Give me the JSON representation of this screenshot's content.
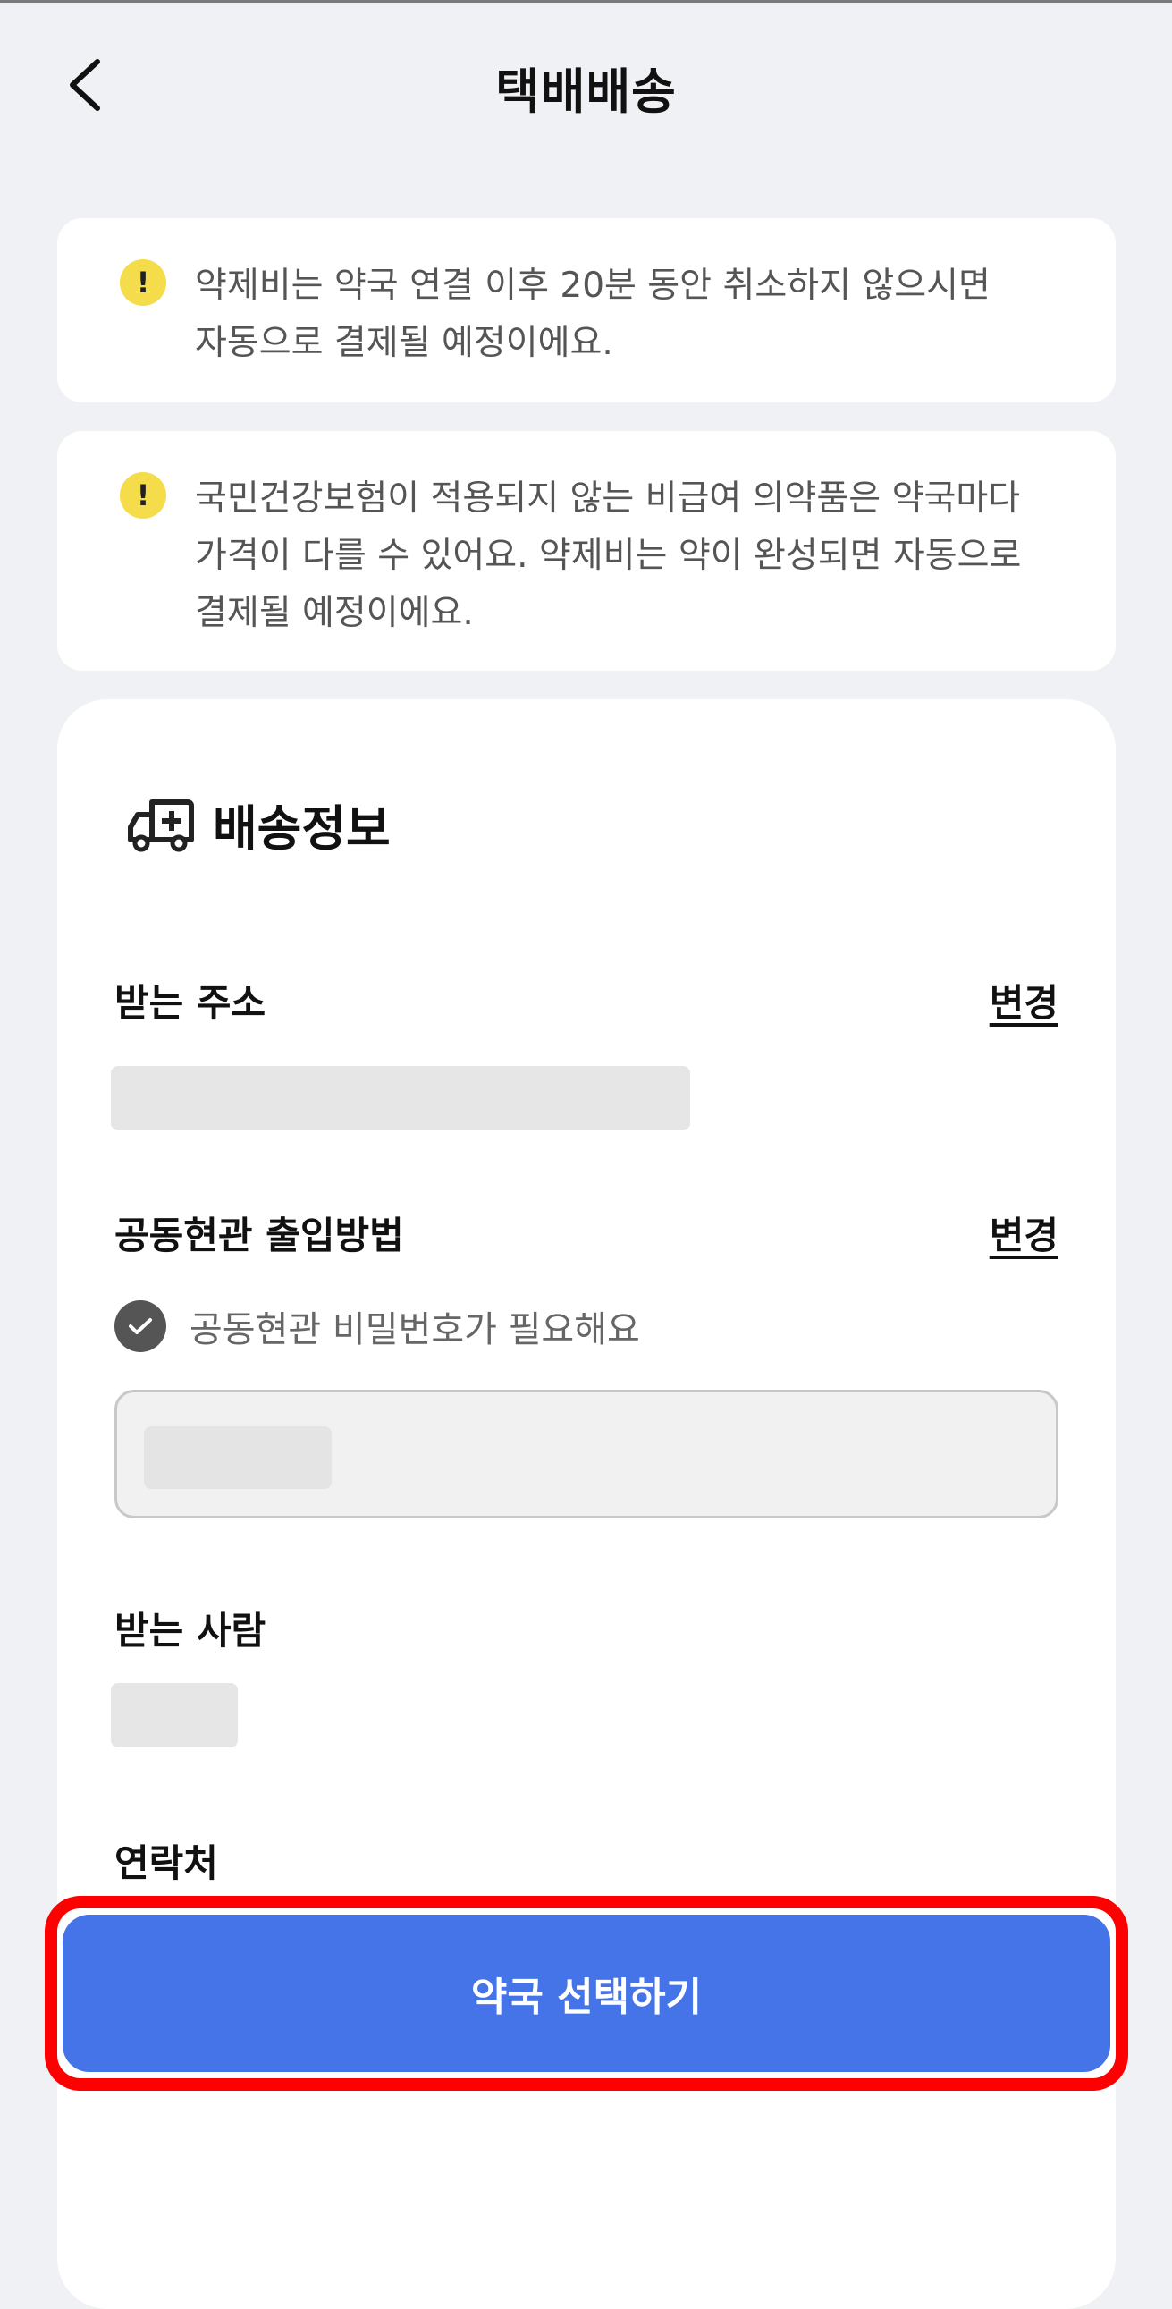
{
  "header": {
    "title": "택배배송"
  },
  "notices": [
    {
      "lines": [
        "약제비는 약국 연결 이후 20분 동안 취소하지 않으시면",
        "자동으로 결제될 예정이에요."
      ]
    },
    {
      "lines": [
        "국민건강보험이 적용되지 않는 비급여 의약품은 약국마다",
        "가격이 다를 수 있어요. 약제비는 약이 완성되면 자동으로",
        "결제될 예정이에요."
      ]
    }
  ],
  "warning_mark": "!",
  "delivery": {
    "section_title": "배송정보",
    "address_label": "받는 주소",
    "change_label": "변경",
    "entrance_label": "공동현관 출입방법",
    "entrance_change_label": "변경",
    "password_needed_text": "공동현관 비밀번호가 필요해요",
    "recipient_label": "받는 사람",
    "contact_label": "연락처"
  },
  "cta": {
    "label": "약국 선택하기"
  },
  "icons": [
    "back-chevron-icon",
    "warning-icon",
    "delivery-truck-icon",
    "check-icon"
  ]
}
